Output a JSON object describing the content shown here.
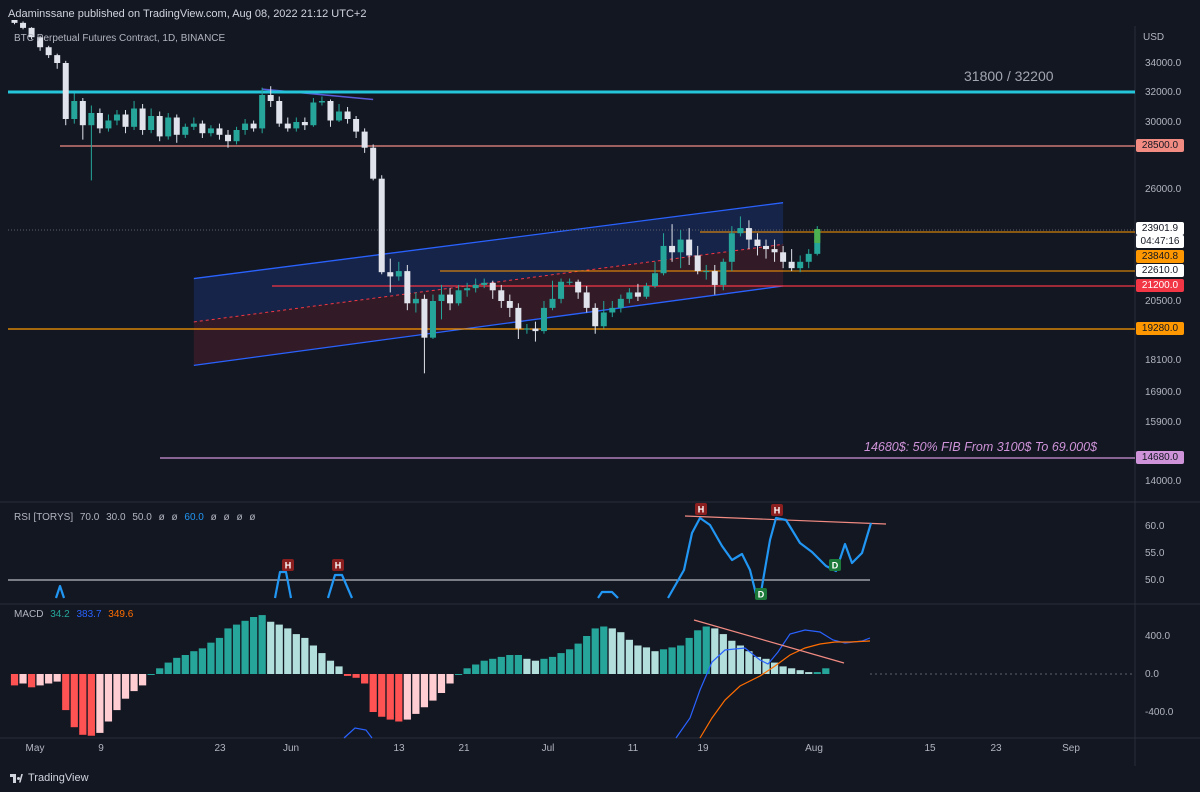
{
  "header": {
    "publish_line": "Adaminssane published on TradingView.com, Aug 08, 2022 21:12 UTC+2"
  },
  "main_pane": {
    "symbol_line": "BTC Perpetual Futures Contract, 1D, BINANCE",
    "currency": "USD",
    "zone_label": "31800 / 32200",
    "fib_note": "14680$: 50% FIB From 3100$ To 69.000$"
  },
  "price_tags": [
    {
      "id": "last",
      "text": "23901.9",
      "bg": "#ffffff",
      "fg": "#131722"
    },
    {
      "id": "countdown",
      "text": "04:47:16",
      "bg": "#ffffff",
      "fg": "#131722"
    },
    {
      "id": "l28500",
      "text": "28500.0",
      "bg": "#f28b82",
      "fg": "#131722"
    },
    {
      "id": "l23840",
      "text": "23840.8",
      "bg": "#ff9800",
      "fg": "#131722"
    },
    {
      "id": "l22610",
      "text": "22610.0",
      "bg": "#ffffff",
      "fg": "#131722"
    },
    {
      "id": "l21200",
      "text": "21200.0",
      "bg": "#f23645",
      "fg": "#ffffff"
    },
    {
      "id": "l19280",
      "text": "19280.0",
      "bg": "#ff9800",
      "fg": "#131722"
    },
    {
      "id": "l14680",
      "text": "14680.0",
      "bg": "#ce93d8",
      "fg": "#131722"
    }
  ],
  "rsi_legend": {
    "name": "RSI [TORYS]",
    "v1": "70.0",
    "v2": "30.0",
    "v3": "50.0",
    "v4": "60.0",
    "phi": "ø"
  },
  "macd_legend": {
    "name": "MACD",
    "hist": "34.2",
    "macd": "383.7",
    "signal": "349.6"
  },
  "footer": {
    "brand": "TradingView"
  },
  "colors": {
    "background": "#131722",
    "up": "#26a69a",
    "down_candle": "#e0e3eb",
    "accent_blue": "#2962ff",
    "rsi_line": "#2196f3"
  },
  "chart_data": [
    {
      "type": "candlestick",
      "title": "BTC Perpetual Futures Contract, 1D, BINANCE",
      "x_axis_labels": [
        "May",
        "9",
        "23",
        "Jun",
        "13",
        "21",
        "Jul",
        "11",
        "19",
        "Aug",
        "15",
        "23",
        "Sep"
      ],
      "y_axis_ticks": [
        34000,
        32000,
        30000,
        26000,
        22610,
        20500,
        18100,
        16900,
        15900,
        14000
      ],
      "y_unit": "USD",
      "last_price": 23901.9,
      "horizontal_levels": [
        {
          "value": 32000,
          "label": "31800 / 32200",
          "color": "#26c6da"
        },
        {
          "value": 28500,
          "label": "28500.0",
          "color": "#f28b82"
        },
        {
          "value": 23840.8,
          "label": "23840.8",
          "color": "#ff9800"
        },
        {
          "value": 22610,
          "label": "22610.0",
          "color": "#ffffff"
        },
        {
          "value": 21200,
          "label": "21200.0",
          "color": "#f23645"
        },
        {
          "value": 19280,
          "label": "19280.0",
          "color": "#ff9800"
        },
        {
          "value": 14680,
          "label": "14680.0",
          "color": "#ce93d8"
        }
      ],
      "channel": {
        "upper": [
          [
            21900,
            21
          ],
          [
            25300,
            90
          ]
        ],
        "lower": [
          [
            17900,
            21
          ],
          [
            21200,
            90
          ]
        ]
      },
      "candles": [
        [
          40000,
          39600,
          40200,
          39400
        ],
        [
          39600,
          38900,
          39800,
          38700
        ],
        [
          38900,
          37600,
          39000,
          37300
        ],
        [
          37600,
          36200,
          37800,
          35700
        ],
        [
          36200,
          35100,
          36400,
          34700
        ],
        [
          35100,
          34000,
          35300,
          33600
        ],
        [
          34000,
          30200,
          34300,
          29800
        ],
        [
          30200,
          31400,
          31900,
          29900
        ],
        [
          31400,
          29800,
          31600,
          28900
        ],
        [
          29800,
          30600,
          31100,
          26500
        ],
        [
          30600,
          29600,
          30900,
          29300
        ],
        [
          29600,
          30100,
          30500,
          29400
        ],
        [
          30100,
          30500,
          30800,
          29800
        ],
        [
          30500,
          29700,
          30800,
          29300
        ],
        [
          29700,
          30900,
          31400,
          29500
        ],
        [
          30900,
          29500,
          31200,
          29200
        ],
        [
          29500,
          30400,
          30900,
          29300
        ],
        [
          30400,
          29100,
          30700,
          28800
        ],
        [
          29100,
          30300,
          30600,
          28900
        ],
        [
          30300,
          29200,
          30500,
          28700
        ],
        [
          29200,
          29700,
          29900,
          29000
        ],
        [
          29700,
          29900,
          30300,
          29500
        ],
        [
          29900,
          29300,
          30100,
          29000
        ],
        [
          29300,
          29600,
          29800,
          29100
        ],
        [
          29600,
          29200,
          29900,
          28900
        ],
        [
          29200,
          28800,
          29500,
          28400
        ],
        [
          28800,
          29500,
          29700,
          28600
        ],
        [
          29500,
          29900,
          30200,
          29200
        ],
        [
          29900,
          29600,
          30100,
          29400
        ],
        [
          29600,
          31800,
          32300,
          29300
        ],
        [
          31800,
          31400,
          32400,
          31000
        ],
        [
          31400,
          29900,
          31700,
          29700
        ],
        [
          29900,
          29600,
          30300,
          29400
        ],
        [
          29600,
          30000,
          30300,
          29400
        ],
        [
          30000,
          29800,
          30300,
          29500
        ],
        [
          29800,
          31300,
          31600,
          29700
        ],
        [
          31300,
          31400,
          31700,
          31100
        ],
        [
          31400,
          30100,
          31500,
          29700
        ],
        [
          30100,
          30700,
          31200,
          30000
        ],
        [
          30700,
          30200,
          31000,
          29900
        ],
        [
          30200,
          29400,
          30400,
          29000
        ],
        [
          29400,
          28400,
          29600,
          28100
        ],
        [
          28400,
          26600,
          28600,
          26500
        ],
        [
          26600,
          22500,
          26800,
          22300
        ],
        [
          22500,
          22100,
          23000,
          20900
        ],
        [
          22100,
          22600,
          22900,
          21700
        ],
        [
          22600,
          20400,
          22800,
          20100
        ],
        [
          20400,
          20600,
          20900,
          20000
        ],
        [
          20600,
          18950,
          20800,
          17600
        ],
        [
          18950,
          20500,
          20800,
          18900
        ],
        [
          20500,
          20800,
          21300,
          19700
        ],
        [
          20800,
          20400,
          21100,
          20100
        ],
        [
          20400,
          21000,
          21300,
          20300
        ],
        [
          21000,
          21100,
          21500,
          20700
        ],
        [
          21100,
          21300,
          21900,
          20900
        ],
        [
          21300,
          21500,
          21900,
          21100
        ],
        [
          21500,
          21000,
          21700,
          20600
        ],
        [
          21000,
          20500,
          21300,
          20200
        ],
        [
          20500,
          20200,
          20800,
          19800
        ],
        [
          20200,
          19300,
          20400,
          18900
        ],
        [
          19300,
          19300,
          19500,
          19100
        ],
        [
          19300,
          19200,
          19600,
          18800
        ],
        [
          19200,
          20200,
          20500,
          19100
        ],
        [
          20200,
          20600,
          21700,
          20100
        ],
        [
          20600,
          21600,
          21900,
          20400
        ],
        [
          21600,
          21600,
          21900,
          21300
        ],
        [
          21600,
          20900,
          21800,
          20600
        ],
        [
          20900,
          20200,
          21200,
          20000
        ],
        [
          20200,
          19400,
          20400,
          19100
        ],
        [
          19400,
          20000,
          20500,
          19300
        ],
        [
          20000,
          20200,
          20500,
          19800
        ],
        [
          20200,
          20600,
          20800,
          20000
        ],
        [
          20600,
          20900,
          21100,
          20400
        ],
        [
          20900,
          20700,
          21400,
          20500
        ],
        [
          20700,
          21200,
          21500,
          20600
        ],
        [
          21200,
          22400,
          22900,
          21100
        ],
        [
          22400,
          23400,
          23800,
          22200
        ],
        [
          23400,
          23200,
          24200,
          22900
        ],
        [
          23200,
          23600,
          23900,
          22700
        ],
        [
          23600,
          23100,
          24000,
          22800
        ],
        [
          23100,
          22600,
          23400,
          22300
        ],
        [
          22600,
          22600,
          22800,
          21800
        ],
        [
          22600,
          21300,
          22800,
          20800
        ],
        [
          21300,
          22900,
          23000,
          21000
        ],
        [
          22900,
          23800,
          24100,
          22600
        ],
        [
          23800,
          24000,
          24600,
          23700
        ],
        [
          24000,
          23600,
          24400,
          23300
        ],
        [
          23600,
          23400,
          23800,
          23100
        ],
        [
          23400,
          23300,
          23600,
          23000
        ],
        [
          23300,
          23200,
          23600,
          22900
        ],
        [
          23200,
          22900,
          23400,
          22700
        ],
        [
          22900,
          22700,
          23300,
          22600
        ],
        [
          22700,
          22900,
          23100,
          22500
        ],
        [
          22900,
          23150,
          23300,
          22700
        ],
        [
          23150,
          23901.9,
          24100,
          23100
        ]
      ]
    },
    {
      "type": "line",
      "title": "RSI [TORYS]",
      "y_axis_ticks": [
        60,
        55,
        50
      ],
      "divergence_marks": [
        "H",
        "H",
        "H",
        "H",
        "D",
        "D"
      ]
    },
    {
      "type": "bar",
      "title": "MACD",
      "y_axis_ticks": [
        400,
        0,
        -400
      ],
      "histogram_last": 34.2,
      "macd_last": 383.7,
      "signal_last": 349.6
    }
  ]
}
